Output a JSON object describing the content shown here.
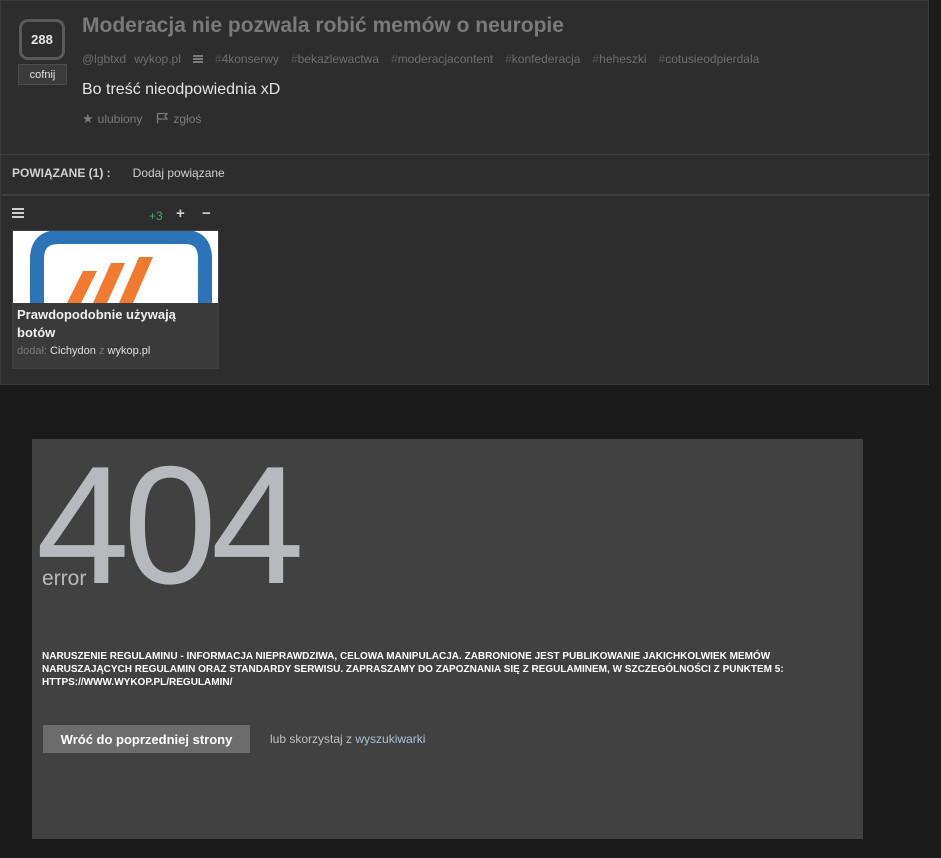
{
  "post": {
    "votes": "288",
    "undo_label": "cofnij",
    "title": "Moderacja nie pozwala robić memów o neuropie",
    "author": "@lgbtxd",
    "source": "wykop.pl",
    "tags": [
      {
        "hash": "#",
        "name": "4konserwy"
      },
      {
        "hash": "#",
        "name": "bekazlewactwa"
      },
      {
        "hash": "#",
        "name": "moderacjacontent"
      },
      {
        "hash": "#",
        "name": "konfederacja"
      },
      {
        "hash": "#",
        "name": "heheszki"
      },
      {
        "hash": "#",
        "name": "cotusieodpierdala"
      }
    ],
    "description": "Bo treść nieodpowiednia xD",
    "favorite_label": "ulubiony",
    "report_label": "zgłoś"
  },
  "related": {
    "label": "POWIĄZANE (1) :",
    "add_label": "Dodaj powiązane",
    "card": {
      "score": "+3",
      "plus": "+",
      "minus": "−",
      "title": "Prawdopodobnie używają botów",
      "added_label": "dodał:",
      "user": "Cichydon",
      "from_label": "z",
      "site": "wykop.pl"
    }
  },
  "error": {
    "code": "404",
    "word": "error",
    "message": "NARUSZENIE REGULAMINU - INFORMACJA NIEPRAWDZIWA, CELOWA MANIPULACJA. ZABRONIONE JEST PUBLIKOWANIE JAKICHKOLWIEK MEMÓW NARUSZAJĄCYCH REGULAMIN ORAZ STANDARDY SERWISU. ZAPRASZAMY DO ZAPOZNANIA SIĘ Z REGULAMINEM, W SZCZEGÓLNOŚCI Z PUNKTEM 5: HTTPS://WWW.WYKOP.PL/REGULAMIN/",
    "back_label": "Wróć do poprzedniej strony",
    "or_label": "lub skorzystaj z",
    "search_link": "wyszukiwarki"
  },
  "colors": {
    "panel_bg": "#2d2d2d",
    "error_bg": "#414141",
    "positive_score": "#4aa36b",
    "link": "#a9c3dc"
  }
}
